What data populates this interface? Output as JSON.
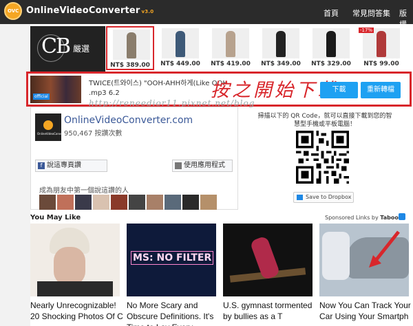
{
  "header": {
    "logo_badge": "OVC",
    "brand": "OnlineVideoConverter",
    "version": "v3.0",
    "nav": [
      "首頁",
      "常見問答集",
      "版權"
    ],
    "hamburger": "="
  },
  "shop": {
    "brand_text": "嚴選",
    "logo_letters": "CB",
    "products": [
      {
        "price": "NT$ 389.00",
        "color": "#8a7d6c"
      },
      {
        "price": "NT$ 449.00",
        "color": "#3e5a78"
      },
      {
        "price": "NT$ 419.00",
        "color": "#b7a28e"
      },
      {
        "price": "NT$ 349.00",
        "color": "#222222"
      },
      {
        "price": "NT$ 329.00",
        "color": "#1a1a1a"
      },
      {
        "price": "NT$ 99.00",
        "color": "#b03a3a",
        "discount": "-17%"
      }
    ]
  },
  "converter": {
    "title": "TWICE(트와이스) \"OOH-AHH하게(Like OOH-AHH)",
    "meta": ".mp3   6.2",
    "thumb_badge": "official",
    "annotation": "按之開始下載→",
    "download_label": "下載",
    "reconvert_label": "重新轉檔",
    "watermark": "http://reneedior11.pixnet.net/blog"
  },
  "facebook": {
    "page_name": "OnlineVideoConverter.com",
    "likes": "950,467 按讚次數",
    "logo_text": "OnlineVideoConverter",
    "share_label": "說這專頁讚",
    "app_label": "使用應用程式",
    "friends_text": "成為朋友中第一個說這讚的人"
  },
  "qr": {
    "instruction": "掃描以下的 QR Code，就可以直接下載到您的智慧型手機或平板電腦！",
    "dropbox_label": "Save to Dropbox"
  },
  "recommend": {
    "title": "You May Like",
    "sponsored": "Sponsored Links by ",
    "sponsor_brand": "Taboola",
    "cards": [
      {
        "text": "Nearly Unrecognizable! 20 Shocking Photos Of C"
      },
      {
        "text": "No More Scary and Obscure Definitions. It's Time to Lay Every",
        "img_text": "MS: NO FILTER"
      },
      {
        "text": "U.S. gymnast tormented by bullies as a T"
      },
      {
        "text": "Now You Can Track Your Car Using Your Smartph"
      }
    ]
  },
  "colors": {
    "nav_bg": "#2b2b2b",
    "accent_orange": "#f5a623",
    "highlight_red": "#d8262b",
    "button_blue": "#1ea1f2",
    "facebook_blue": "#3b5998"
  }
}
